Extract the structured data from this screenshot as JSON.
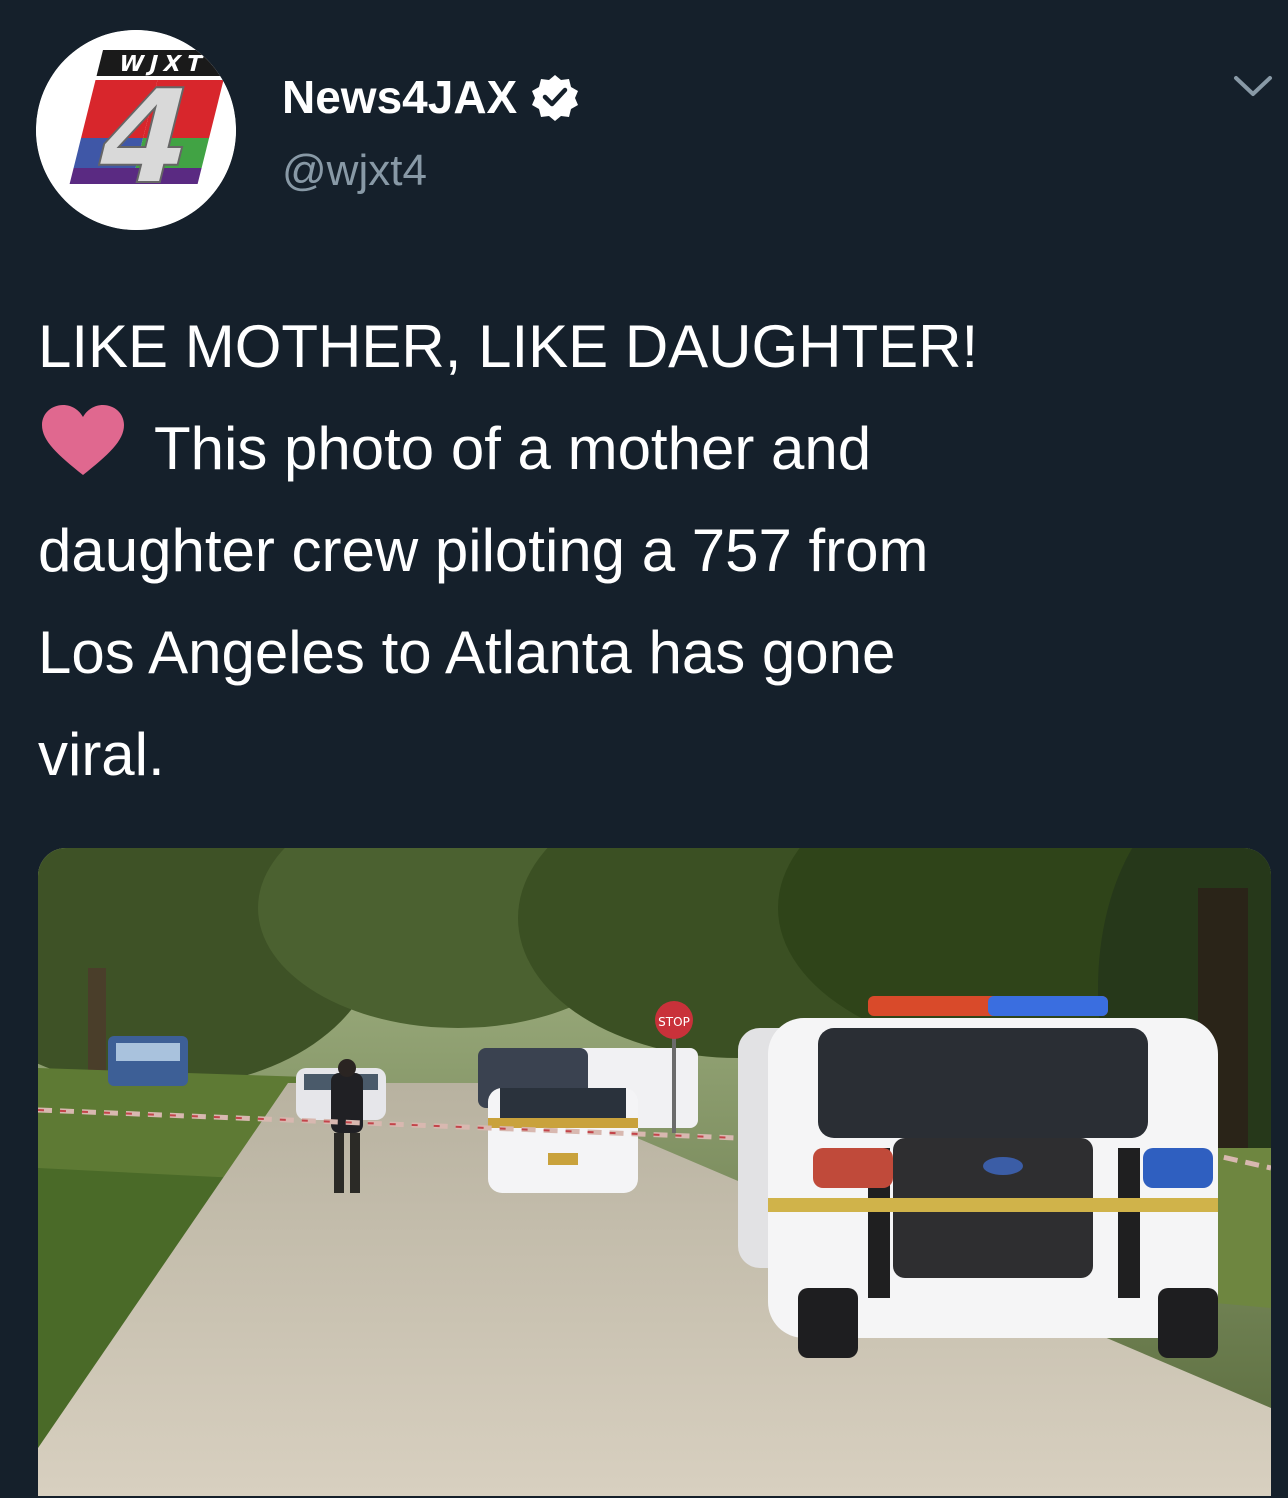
{
  "account": {
    "display_name": "News4JAX",
    "handle": "@wjxt4",
    "verified": true,
    "avatar_logo_text": "WJXT",
    "avatar_logo_numeral": "4"
  },
  "tweet": {
    "line1": "LIKE MOTHER, LIKE DAUGHTER!",
    "line2": "This photo of a mother and",
    "line3": "daughter crew piloting a 757 from",
    "line4": "Los Angeles to Atlanta has gone",
    "line5": "viral.",
    "emoji": "heart-icon"
  },
  "media": {
    "stop_sign_text": "STOP",
    "description_icon": "police-scene-photo"
  },
  "icons": {
    "verified": "verified-badge-icon",
    "menu": "chevron-down-icon"
  },
  "colors": {
    "background": "#15202b",
    "secondary_text": "#8899a6",
    "heart": "#e0688f"
  }
}
